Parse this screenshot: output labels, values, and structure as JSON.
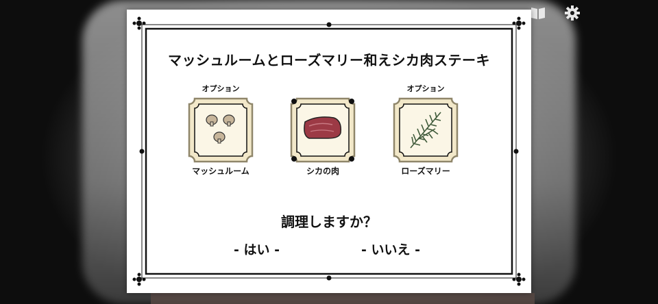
{
  "dialog": {
    "recipe_title": "マッシュルームとローズマリー和えシカ肉ステーキ",
    "question": "調理しますか？",
    "yes_label": "- はい -",
    "no_label": "- いいえ -"
  },
  "ingredients": [
    {
      "tag": "オプション",
      "name": "マッシュルーム",
      "icon": "mushroom-icon"
    },
    {
      "tag": "",
      "name": "シカの肉",
      "icon": "venison-meat-icon"
    },
    {
      "tag": "オプション",
      "name": "ローズマリー",
      "icon": "rosemary-icon"
    }
  ],
  "top_bar": {
    "icons": [
      "notebook-icon",
      "gear-icon"
    ]
  },
  "colors": {
    "card_fill": "#f2e8c9",
    "card_border": "#8f866a",
    "frame": "#111111",
    "meat": "#9c3a45",
    "herb": "#3f5a3a"
  }
}
